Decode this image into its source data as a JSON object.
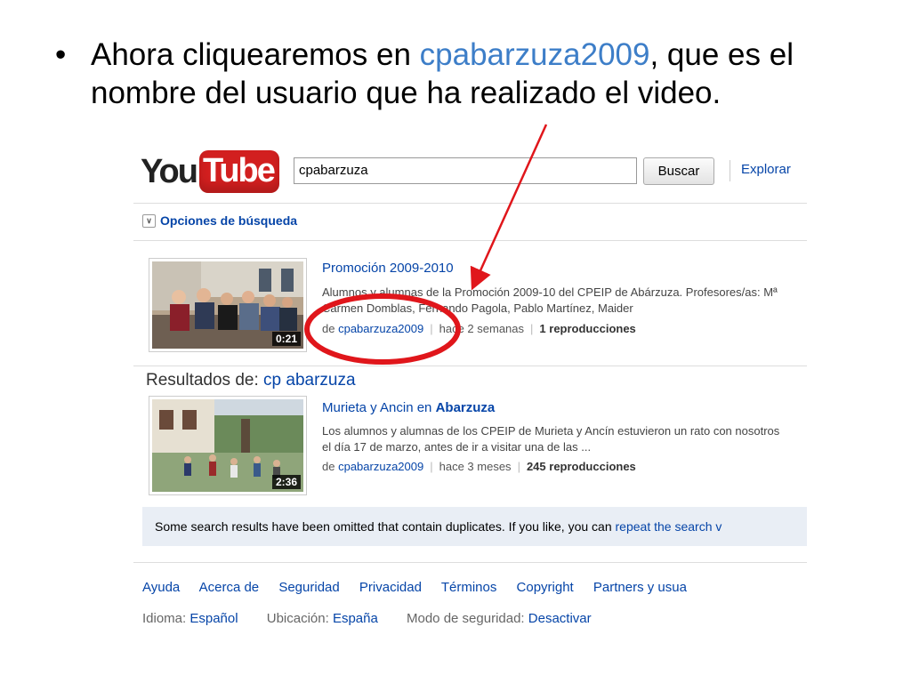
{
  "slide": {
    "bullet": "•",
    "text_before": "Ahora cliquearemos en ",
    "username_highlight": "cpabarzuza2009",
    "text_after": ", que es el nombre del usuario que ha realizado el video."
  },
  "header": {
    "logo_you": "You",
    "logo_tube": "Tube",
    "search_value": "cpabarzuza",
    "search_button": "Buscar",
    "explore_link": "Explorar"
  },
  "search_options": {
    "label": "Opciones de búsqueda"
  },
  "results": [
    {
      "title": "Promoción 2009-2010",
      "description": "Alumnos y alumnas de la Promoción 2009-10 del CPEIP de Abárzuza. Profesores/as: Mª Carmen Domblas, Fernando Pagola, Pablo Martínez, Maider",
      "by_prefix": "de",
      "author": "cpabarzuza2009",
      "age": "hace 2 semanas",
      "views": "1 reproducciones",
      "duration": "0:21"
    },
    {
      "title_prefix": "Murieta y Ancin en ",
      "title_bold": "Abarzuza",
      "description": "Los alumnos y alumnas de los CPEIP de Murieta y Ancín estuvieron un rato con nosotros el día 17 de marzo, antes de ir a visitar una de las ...",
      "by_prefix": "de",
      "author": "cpabarzuza2009",
      "age": "hace 3 meses",
      "views": "245 reproducciones",
      "duration": "2:36"
    }
  ],
  "results_for": {
    "label": "Resultados de: ",
    "query": "cp abarzuza"
  },
  "omitted_notice": {
    "text": "Some search results have been omitted that contain duplicates. If you like, you can ",
    "link": "repeat the search v"
  },
  "footer": {
    "links": [
      "Ayuda",
      "Acerca de",
      "Seguridad",
      "Privacidad",
      "Términos",
      "Copyright",
      "Partners y usua"
    ],
    "language_label": "Idioma: ",
    "language_value": "Español",
    "location_label": "Ubicación: ",
    "location_value": "España",
    "safety_label": "Modo de seguridad: ",
    "safety_value": "Desactivar"
  },
  "colors": {
    "accent": "#3d7ec8",
    "link": "#0645a8",
    "annotation_red": "#e0161b",
    "logo_red": "#d21f1f"
  }
}
